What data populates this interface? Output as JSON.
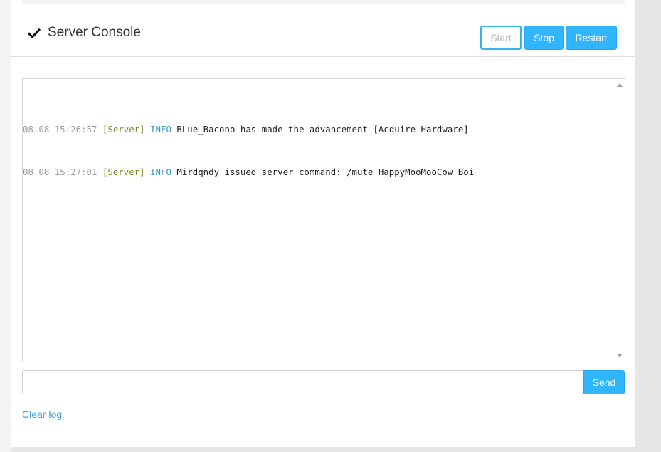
{
  "header": {
    "title": "Server Console",
    "check_icon": "checkmark-icon"
  },
  "controls": {
    "start_label": "Start",
    "stop_label": "Stop",
    "restart_label": "Restart"
  },
  "console": {
    "lines": [
      {
        "timestamp": "08.08 15:26:57",
        "source": "[Server]",
        "level": "INFO",
        "message": "BLue_Bacono has made the advancement [Acquire Hardware]"
      },
      {
        "timestamp": "08.08 15:27:01",
        "source": "[Server]",
        "level": "INFO",
        "message": "Mirdqndy issued server command: /mute HappyMooMooCow Boi"
      }
    ]
  },
  "command": {
    "value": "",
    "placeholder": "",
    "send_label": "Send"
  },
  "footer": {
    "clear_log_label": "Clear log"
  },
  "colors": {
    "accent": "#31b5ff",
    "timestamp": "#999999",
    "source": "#7d8a26",
    "level": "#3a9bc2",
    "link": "#3aa0e0"
  }
}
